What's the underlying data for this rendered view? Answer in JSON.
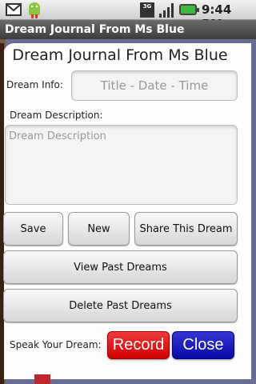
{
  "status_bar": {
    "time": "9:44 PM",
    "network": "3G",
    "icons": [
      "gmail-icon",
      "android-icon",
      "network-3g-icon",
      "signal-icon",
      "battery-icon"
    ]
  },
  "title_bar": {
    "title": "Dream Journal From Ms Blue"
  },
  "app": {
    "heading": "Dream Journal From Ms Blue",
    "dream_info_label": "Dream Info:",
    "dream_info_placeholder": "Title - Date - Time",
    "dream_description_label": "Dream Description:",
    "dream_description_placeholder": "Dream Description",
    "buttons": {
      "save": "Save",
      "new": "New",
      "share": "Share This Dream",
      "view_past": "View Past Dreams",
      "delete_past": "Delete Past Dreams",
      "record": "Record",
      "close": "Close"
    },
    "speak_label": "Speak Your Dream:"
  },
  "colors": {
    "frame": "#6b6e94",
    "record": "#e01f1f",
    "close": "#1c1cbf",
    "bookmark": "#c0262d"
  }
}
